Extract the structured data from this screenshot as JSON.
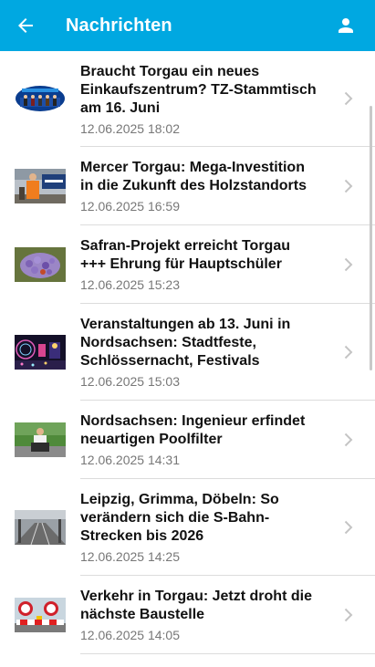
{
  "header": {
    "title": "Nachrichten",
    "back_icon": "arrow-back-icon",
    "profile_icon": "person-icon",
    "color": "#00a8e1"
  },
  "news": [
    {
      "title": "Braucht Torgau ein neues Einkaufszentrum? TZ-Stammtisch am 16. Juni",
      "date": "12.06.2025 18:02"
    },
    {
      "title": "Mercer Torgau: Mega-Investition in die Zukunft des Holzstandorts",
      "date": "12.06.2025 16:59"
    },
    {
      "title": "Safran-Projekt erreicht Torgau +++ Ehrung für Hauptschüler",
      "date": "12.06.2025 15:23"
    },
    {
      "title": "Veranstaltungen ab 13. Juni in Nordsachsen: Stadtfeste, Schlössernacht, Festivals",
      "date": "12.06.2025 15:03"
    },
    {
      "title": "Nordsachsen: Ingenieur erfindet neuartigen Poolfilter",
      "date": "12.06.2025 14:31"
    },
    {
      "title": "Leipzig, Grimma, Döbeln: So verändern sich die S-Bahn-Strecken bis 2026",
      "date": "12.06.2025 14:25"
    },
    {
      "title": "Verkehr in Torgau: Jetzt droht die nächste Baustelle",
      "date": "12.06.2025 14:05"
    }
  ]
}
